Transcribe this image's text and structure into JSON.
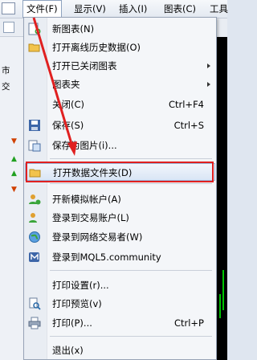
{
  "menubar": {
    "file": "文件(F)",
    "view": "显示(V)",
    "insert": "插入(I)",
    "charts": "图表(C)",
    "tools": "工具"
  },
  "left_panel": {
    "label_1": "市",
    "label_2": "交"
  },
  "file_menu": {
    "new_chart": "新图表(N)",
    "open_offline": "打开离线历史数据(O)",
    "open_deleted": "打开已关闭图表",
    "profiles": "图表夹",
    "close": "关闭(C)",
    "close_shortcut": "Ctrl+F4",
    "save": "保存(S)",
    "save_shortcut": "Ctrl+S",
    "save_as_picture": "保存为图片(i)...",
    "open_data_folder": "打开数据文件夹(D)",
    "open_demo_account": "开新模拟帐户(A)",
    "login_trade": "登录到交易账户(L)",
    "login_web": "登录到网络交易者(W)",
    "login_mql5": "登录到MQL5.community",
    "print_setup": "打印设置(r)...",
    "print_preview": "打印预览(v)",
    "print": "打印(P)...",
    "print_shortcut": "Ctrl+P",
    "exit": "退出(x)"
  },
  "colors": {
    "highlight_box": "#e02020",
    "arrow": "#e02020"
  }
}
